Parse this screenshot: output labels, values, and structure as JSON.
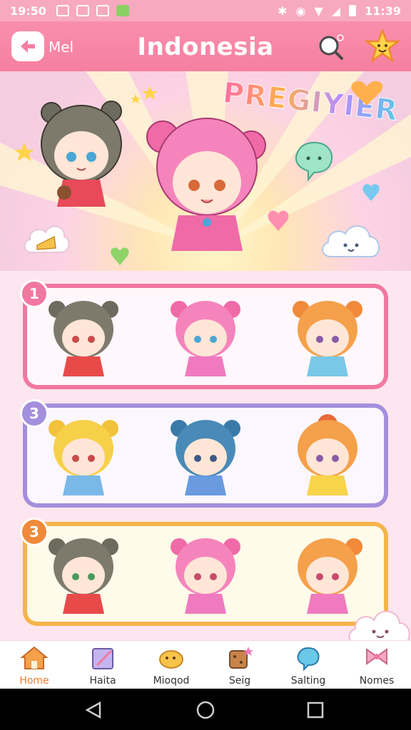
{
  "status_bar": {
    "time_left": "19:50",
    "time_right": "11:39"
  },
  "app_bar": {
    "back_label": "Mel",
    "title": "Indonesia"
  },
  "hero": {
    "banner_text": "PREGIYIER"
  },
  "groups": [
    {
      "badge": "1",
      "color": "#f0789f",
      "characters": [
        "grey-hair-bear-girl",
        "pink-hair-bun-girl",
        "orange-hair-bun-girl"
      ]
    },
    {
      "badge": "3",
      "color": "#a48fdc",
      "characters": [
        "yellow-hair-girl",
        "blue-hair-girl",
        "orange-hair-cap-girl"
      ]
    },
    {
      "badge": "3",
      "color": "#f4b54c",
      "characters": [
        "grey-hair-bear-girl",
        "pink-hair-girl",
        "orange-hair-girl"
      ]
    }
  ],
  "bottom_nav": [
    {
      "label": "Home",
      "icon": "house-icon",
      "active": true
    },
    {
      "label": "Haita",
      "icon": "book-icon",
      "active": false
    },
    {
      "label": "Mioqod",
      "icon": "duck-icon",
      "active": false
    },
    {
      "label": "Seig",
      "icon": "cookie-icon",
      "active": false
    },
    {
      "label": "Salting",
      "icon": "chat-bubble-icon",
      "active": false
    },
    {
      "label": "Nomes",
      "icon": "bow-icon",
      "active": false
    }
  ]
}
